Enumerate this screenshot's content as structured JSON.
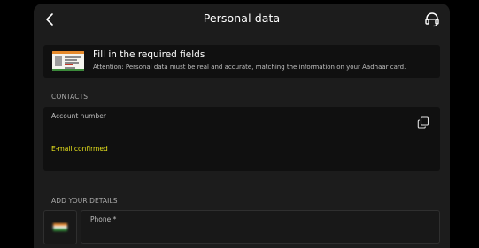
{
  "header": {
    "title": "Personal data",
    "back_icon": "chevron-left-icon",
    "support_icon": "headset-icon"
  },
  "notice": {
    "image_icon": "aadhaar-card-icon",
    "title": "Fill in the required fields",
    "subtitle": "Attention: Personal data must be real and accurate, matching the information on your Aadhaar card."
  },
  "contacts": {
    "section_label": "CONTACTS",
    "account_label": "Account number",
    "copy_icon": "copy-icon",
    "email_status": "E-mail confirmed"
  },
  "details": {
    "section_label": "ADD YOUR DETAILS",
    "country_flag_icon": "india-flag-icon",
    "phone_label": "Phone *"
  },
  "colors": {
    "background": "#000000",
    "panel": "#1c1c1c",
    "box": "#101010",
    "accent_yellow": "#e7e21c",
    "text": "#ffffff",
    "muted": "#a9a9a9"
  }
}
